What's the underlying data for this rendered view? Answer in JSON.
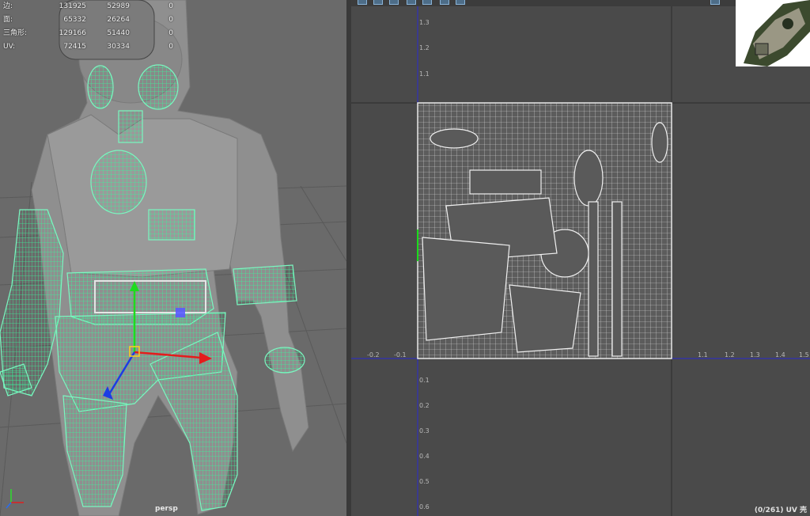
{
  "viewport": {
    "camera_label": "persp",
    "stats": [
      {
        "label": "边:",
        "a": "131925",
        "b": "52989",
        "c": "0"
      },
      {
        "label": "面:",
        "a": "65332",
        "b": "26264",
        "c": "0"
      },
      {
        "label": "三角形:",
        "a": "129166",
        "b": "51440",
        "c": "0"
      },
      {
        "label": "UV:",
        "a": "72415",
        "b": "30334",
        "c": "0"
      }
    ]
  },
  "uv_editor": {
    "status": "(0/261) UV 壳",
    "u_ticks": [
      "-0.2",
      "-0.1",
      "1.1",
      "1.2",
      "1.3",
      "1.4",
      "1.5"
    ],
    "v_ticks_up": [
      "1.3",
      "1.2",
      "1.1"
    ],
    "v_ticks_down": [
      "0.1",
      "0.2",
      "0.3",
      "0.4",
      "0.5",
      "0.6"
    ]
  },
  "colors": {
    "wireframe": "#3cf29a",
    "uv_axis": "#2a2ad0",
    "viewport_bg": "#6a6a6a",
    "uv_bg": "#4a4a4a"
  }
}
